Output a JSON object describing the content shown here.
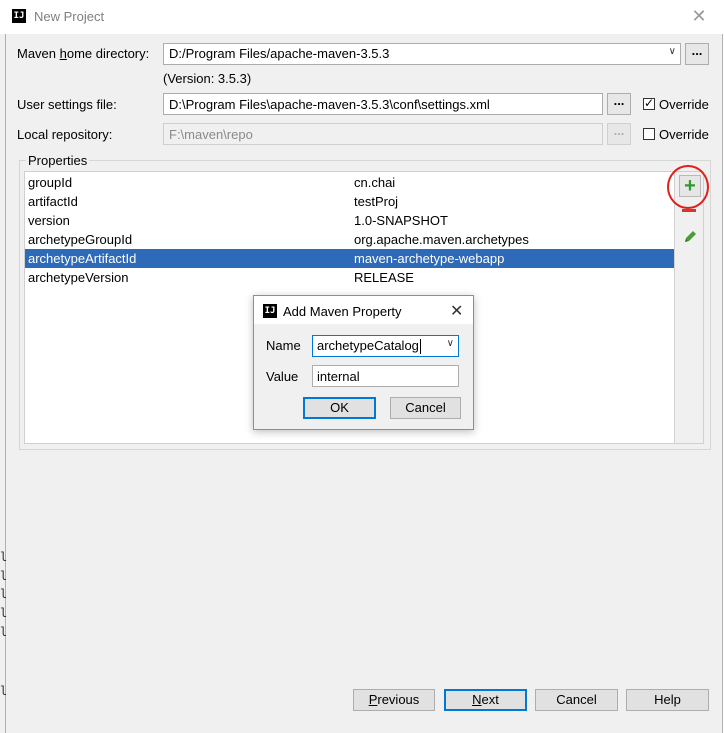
{
  "window": {
    "title": "New Project"
  },
  "maven_home": {
    "label": "Maven home directory:",
    "value": "D:/Program Files/apache-maven-3.5.3",
    "version": "(Version: 3.5.3)"
  },
  "user_settings": {
    "label": "User settings file:",
    "value": "D:\\Program Files\\apache-maven-3.5.3\\conf\\settings.xml",
    "override_label": "Override",
    "override_checked": true
  },
  "local_repo": {
    "label": "Local repository:",
    "value": "F:\\maven\\repo",
    "override_label": "Override",
    "override_checked": false
  },
  "browse_label": "...",
  "properties": {
    "title": "Properties",
    "rows": [
      {
        "key": "groupId",
        "value": "cn.chai"
      },
      {
        "key": "artifactId",
        "value": "testProj"
      },
      {
        "key": "version",
        "value": "1.0-SNAPSHOT"
      },
      {
        "key": "archetypeGroupId",
        "value": "org.apache.maven.archetypes"
      },
      {
        "key": "archetypeArtifactId",
        "value": "maven-archetype-webapp",
        "selected": true
      },
      {
        "key": "archetypeVersion",
        "value": "RELEASE"
      }
    ],
    "add_icon": "+",
    "colors": {
      "selection": "#2d6ab7",
      "add": "#2c9a2c",
      "remove": "#d9342b",
      "annotation": "#e0201b"
    }
  },
  "dialog": {
    "title": "Add Maven Property",
    "name_label": "Name",
    "name_value": "archetypeCatalog",
    "value_label": "Value",
    "value_value": "internal",
    "ok_label": "OK",
    "cancel_label": "Cancel"
  },
  "footer": {
    "previous_label": "Previous",
    "next_label": "Next",
    "cancel_label": "Cancel",
    "help_label": "Help"
  }
}
